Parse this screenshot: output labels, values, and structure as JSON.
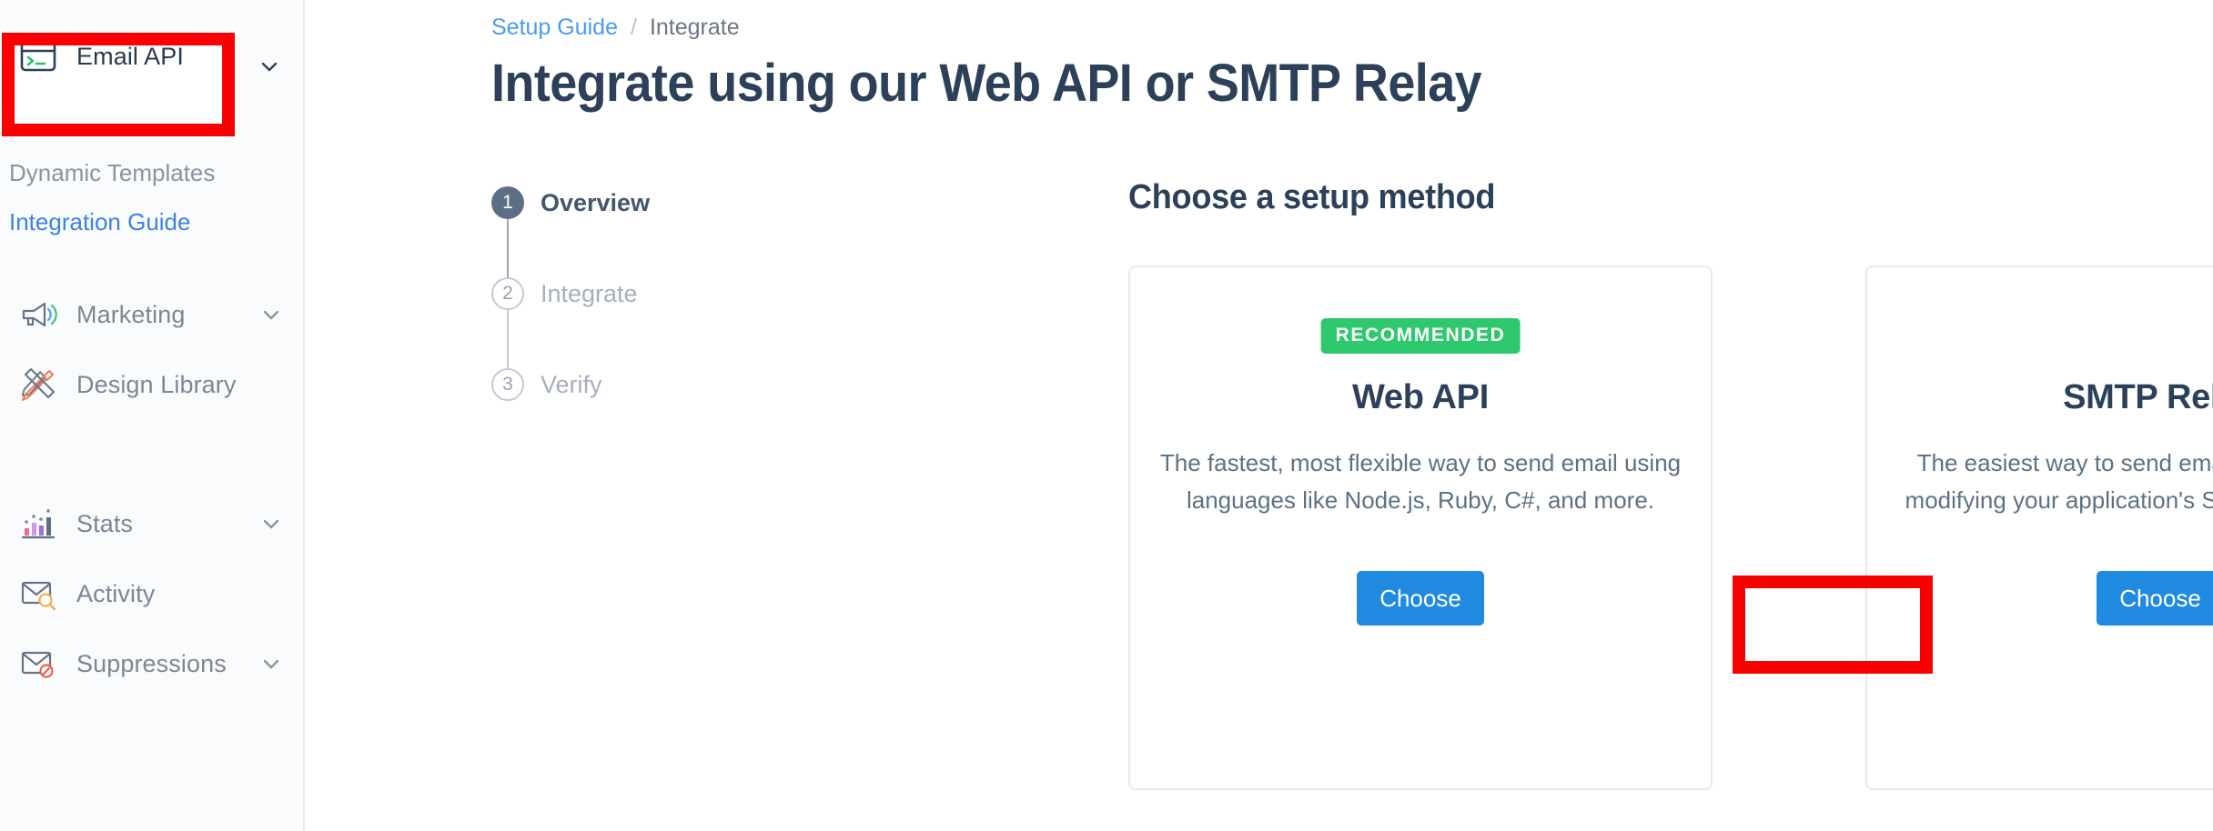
{
  "sidebar": {
    "items": [
      {
        "label": "Email API",
        "icon": "terminal-icon",
        "type": "group",
        "chevron": true,
        "highlighted": true
      },
      {
        "label": "Dynamic Templates",
        "icon": null,
        "type": "sublink",
        "chevron": false,
        "state": "muted"
      },
      {
        "label": "Integration Guide",
        "icon": null,
        "type": "sublink",
        "chevron": false,
        "state": "active"
      },
      {
        "label": "Marketing",
        "icon": "megaphone-icon",
        "type": "group",
        "chevron": true
      },
      {
        "label": "Design Library",
        "icon": "ruler-pencil-icon",
        "type": "group",
        "chevron": false
      },
      {
        "label": "Stats",
        "icon": "bar-chart-icon",
        "type": "group",
        "chevron": true
      },
      {
        "label": "Activity",
        "icon": "envelope-search-icon",
        "type": "group",
        "chevron": false
      },
      {
        "label": "Suppressions",
        "icon": "envelope-block-icon",
        "type": "group",
        "chevron": true
      }
    ]
  },
  "breadcrumb": {
    "parent": "Setup Guide",
    "separator": "/",
    "current": "Integrate"
  },
  "header": {
    "title": "Integrate using our Web API or SMTP Relay"
  },
  "stepper": {
    "steps": [
      {
        "number": "1",
        "label": "Overview",
        "state": "active"
      },
      {
        "number": "2",
        "label": "Integrate",
        "state": "idle"
      },
      {
        "number": "3",
        "label": "Verify",
        "state": "idle"
      }
    ]
  },
  "main": {
    "section_title": "Choose a setup method",
    "cards": [
      {
        "badge": "RECOMMENDED",
        "title": "Web API",
        "description": "The fastest, most flexible way to send email using languages like Node.js, Ruby, C#, and more.",
        "button": "Choose"
      },
      {
        "badge": null,
        "title": "SMTP Relay",
        "description": "The easiest way to send email. It only requires modifying your application's SMTP configuration.",
        "button": "Choose"
      }
    ]
  },
  "colors": {
    "accent_blue": "#1f8ae0",
    "link_blue": "#3b82e8",
    "badge_green": "#2ec96d",
    "heading_navy": "#2c4159",
    "annotation_red": "#fb0000",
    "sidebar_bg": "#fafbfc"
  }
}
